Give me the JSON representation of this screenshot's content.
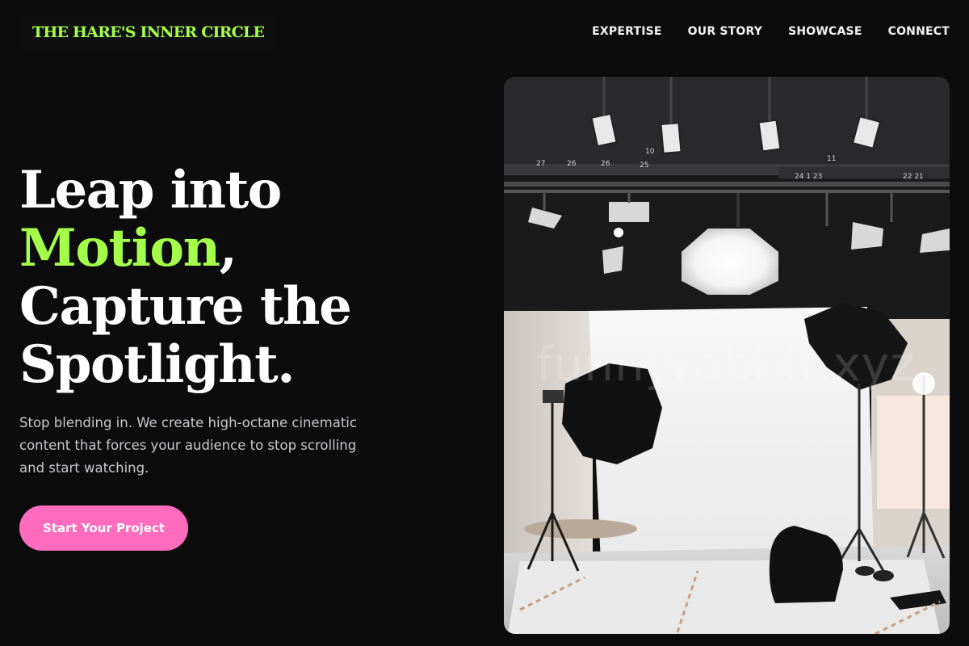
{
  "brand": {
    "name": "THE HARE'S INNER CIRCLE",
    "accent_color": "#a4ff4a",
    "cta_color": "#ff6bbd"
  },
  "nav": {
    "items": [
      {
        "label": "EXPERTISE"
      },
      {
        "label": "OUR STORY"
      },
      {
        "label": "SHOWCASE"
      },
      {
        "label": "CONNECT"
      }
    ]
  },
  "hero": {
    "headline": {
      "line1": "Leap into",
      "accent": "Motion",
      "accent_suffix": ",",
      "line3": "Capture the",
      "line4": "Spotlight."
    },
    "subtext": "Stop blending in. We create high-octane cinematic content that forces your audience to stop scrolling and start watching.",
    "cta_label": "Start Your Project"
  },
  "image": {
    "alt": "photo studio with lights and white backdrop",
    "watermark": "funnyrabbit.xyz"
  }
}
